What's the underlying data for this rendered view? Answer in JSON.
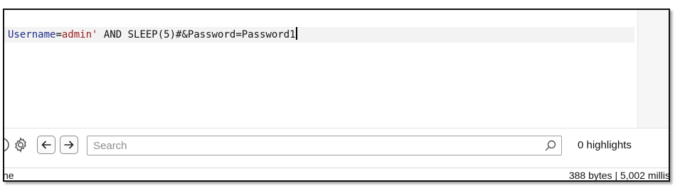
{
  "editor": {
    "request_line": {
      "param1_name": "Username",
      "param1_eq": "=",
      "param1_value": "admin'",
      "payload": " AND SLEEP(5)#&Password=Password1"
    }
  },
  "search": {
    "placeholder": "Search",
    "highlights": "0 highlights"
  },
  "status": {
    "left": "ne",
    "right": "388 bytes | 5,002 millis"
  },
  "icons": {
    "settings": "gear-icon",
    "back": "arrow-left-icon",
    "forward": "arrow-right-icon",
    "search": "search-icon"
  },
  "colors": {
    "param_name": "#1c2a8a",
    "param_value": "#9a1b1b",
    "line_highlight": "#f3f3f3"
  }
}
